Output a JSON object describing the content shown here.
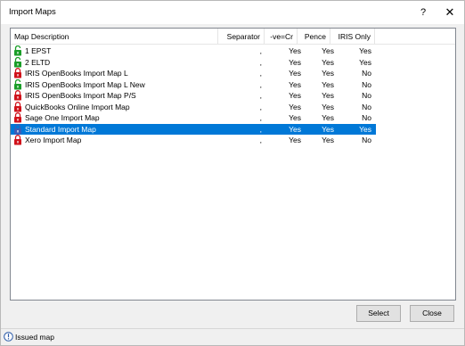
{
  "window": {
    "title": "Import Maps",
    "help_label": "?",
    "close_label": "✕"
  },
  "table": {
    "columns": [
      "Map Description",
      "Separator",
      "-ve=Cr",
      "Pence",
      "IRIS Only"
    ],
    "rows": [
      {
        "name": "1 EPST",
        "separator": ",",
        "ve_cr": "Yes",
        "pence": "Yes",
        "iris_only": "Yes",
        "lock": "green-unlocked"
      },
      {
        "name": "2 ELTD",
        "separator": ",",
        "ve_cr": "Yes",
        "pence": "Yes",
        "iris_only": "Yes",
        "lock": "green-unlocked"
      },
      {
        "name": "IRIS OpenBooks Import Map L",
        "separator": ",",
        "ve_cr": "Yes",
        "pence": "Yes",
        "iris_only": "No",
        "lock": "red-locked"
      },
      {
        "name": "IRIS OpenBooks Import Map L New",
        "separator": ",",
        "ve_cr": "Yes",
        "pence": "Yes",
        "iris_only": "No",
        "lock": "green-unlocked"
      },
      {
        "name": "IRIS OpenBooks Import Map P/S",
        "separator": ",",
        "ve_cr": "Yes",
        "pence": "Yes",
        "iris_only": "No",
        "lock": "red-locked"
      },
      {
        "name": "QuickBooks Online Import Map",
        "separator": ",",
        "ve_cr": "Yes",
        "pence": "Yes",
        "iris_only": "No",
        "lock": "red-locked"
      },
      {
        "name": "Sage One Import Map",
        "separator": ",",
        "ve_cr": "Yes",
        "pence": "Yes",
        "iris_only": "No",
        "lock": "red-locked"
      },
      {
        "name": "Standard Import Map",
        "separator": ",",
        "ve_cr": "Yes",
        "pence": "Yes",
        "iris_only": "Yes",
        "lock": "blue-locked",
        "selected": true
      },
      {
        "name": "Xero Import Map",
        "separator": ",",
        "ve_cr": "Yes",
        "pence": "Yes",
        "iris_only": "No",
        "lock": "red-locked"
      }
    ]
  },
  "buttons": {
    "select_label": "Select",
    "close_label": "Close"
  },
  "status": {
    "text": "Issued map",
    "icon": "info-icon"
  },
  "colors": {
    "selection": "#0078d7",
    "lock_red": "#d0121b",
    "lock_green": "#1a9e28",
    "lock_blue": "#3b5db8"
  }
}
